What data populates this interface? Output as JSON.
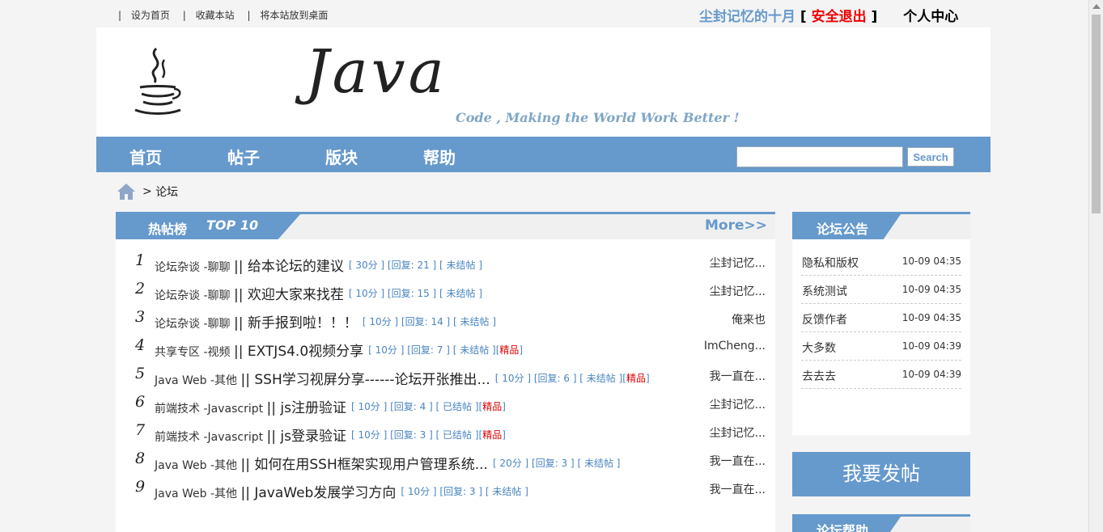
{
  "topbar": {
    "links": [
      "设为首页",
      "收藏本站",
      "将本站放到桌面"
    ],
    "separator": "|",
    "username": "尘封记忆的十月",
    "bracket_open": "[",
    "logout": "安全退出",
    "bracket_close": "]",
    "personal_center": "个人中心"
  },
  "banner": {
    "logo_text": "Java",
    "slogan": "Code , Making the World Work Better !"
  },
  "nav": {
    "items": [
      "首页",
      "帖子",
      "版块",
      "帮助"
    ],
    "search_value": "",
    "search_button": "Search"
  },
  "breadcrumb": {
    "sep": ">",
    "current": "论坛"
  },
  "hot": {
    "title": "热帖榜",
    "subtitle": "TOP 10",
    "more": "More>>",
    "rows": [
      {
        "idx": "1",
        "cat": "论坛杂谈 -聊聊",
        "title": "给本论坛的建议",
        "meta": "[ 30分 ] [回复: 21 ] [ 未结帖 ]",
        "jing": "",
        "author": "尘封记忆..."
      },
      {
        "idx": "2",
        "cat": "论坛杂谈 -聊聊",
        "title": "欢迎大家来找茬",
        "meta": "[ 10分 ] [回复: 15 ] [ 未结帖 ]",
        "jing": "",
        "author": "尘封记忆..."
      },
      {
        "idx": "3",
        "cat": "论坛杂谈 -聊聊",
        "title": "新手报到啦！！！",
        "meta": "[ 10分 ] [回复: 14 ] [ 未结帖 ]",
        "jing": "",
        "author": "俺来也"
      },
      {
        "idx": "4",
        "cat": "共享专区 -视频",
        "title": "EXTJS4.0视频分享",
        "meta": "[ 10分 ] [回复: 7 ] [ 未结帖 ][",
        "jing": "精品",
        "author": "ImCheng..."
      },
      {
        "idx": "5",
        "cat": "Java Web -其他",
        "title": "SSH学习视屏分享------论坛开张推出...",
        "meta": "[ 10分 ] [回复: 6 ] [ 未结帖 ][",
        "jing": "精品",
        "author": "我一直在..."
      },
      {
        "idx": "6",
        "cat": "前端技术 -Javascript",
        "title": "js注册验证",
        "meta": "[ 10分 ] [回复: 4 ] [ 已结帖 ][",
        "jing": "精品",
        "author": "尘封记忆..."
      },
      {
        "idx": "7",
        "cat": "前端技术 -Javascript",
        "title": "js登录验证",
        "meta": "[ 10分 ] [回复: 3 ] [ 已结帖 ][",
        "jing": "精品",
        "author": "尘封记忆..."
      },
      {
        "idx": "8",
        "cat": "Java Web -其他",
        "title": "如何在用SSH框架实现用户管理系统...",
        "meta": "[ 20分 ] [回复: 3 ] [ 未结帖 ]",
        "jing": "",
        "author": "我一直在..."
      },
      {
        "idx": "9",
        "cat": "Java Web -其他",
        "title": "JavaWeb发展学习方向",
        "meta": "[ 10分 ] [回复: 3 ] [ 未结帖 ]",
        "jing": "",
        "author": "我一直在..."
      }
    ]
  },
  "notice": {
    "title": "论坛公告",
    "items": [
      {
        "title": "隐私和版权",
        "date": "10-09 04:35"
      },
      {
        "title": "系统测试",
        "date": "10-09 04:35"
      },
      {
        "title": "反馈作者",
        "date": "10-09 04:35"
      },
      {
        "title": "大多数",
        "date": "10-09 04:39"
      },
      {
        "title": "去去去",
        "date": "10-09 04:39"
      }
    ]
  },
  "post_button": "我要发帖",
  "help": {
    "title": "论坛帮助"
  },
  "colors": {
    "accent": "#6699cc",
    "logout": "#ee0000",
    "jing": "#dd0000"
  }
}
